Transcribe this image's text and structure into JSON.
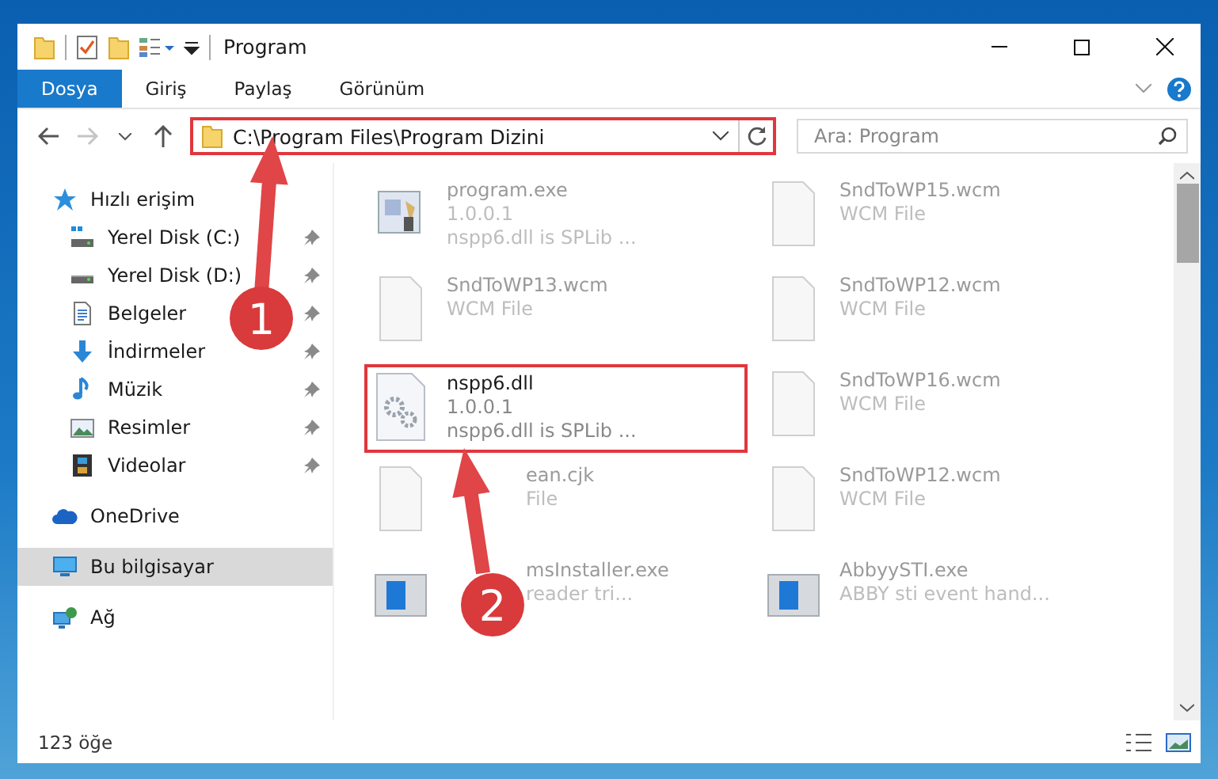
{
  "window": {
    "title": "Program"
  },
  "ribbon_tabs": [
    {
      "label": "Dosya",
      "selected": true
    },
    {
      "label": "Giriş",
      "selected": false
    },
    {
      "label": "Paylaş",
      "selected": false
    },
    {
      "label": "Görünüm",
      "selected": false
    }
  ],
  "address_bar": {
    "path": "C:\\Program Files\\Program Dizini",
    "highlighted": true
  },
  "search": {
    "placeholder": "Ara: Program"
  },
  "sidebar": {
    "items": [
      {
        "label": "Hızlı erişim",
        "kind": "star",
        "pinned": false,
        "selected": false,
        "children": [
          {
            "label": "Yerel Disk (C:)",
            "kind": "system-drive",
            "pinned": true,
            "selected": false
          },
          {
            "label": "Yerel Disk (D:)",
            "kind": "drive",
            "pinned": true,
            "selected": false
          },
          {
            "label": "Belgeler",
            "kind": "document",
            "pinned": true,
            "selected": false
          },
          {
            "label": "İndirmeler",
            "kind": "download",
            "pinned": true,
            "selected": false
          },
          {
            "label": "Müzik",
            "kind": "music",
            "pinned": true,
            "selected": false
          },
          {
            "label": "Resimler",
            "kind": "picture",
            "pinned": true,
            "selected": false
          },
          {
            "label": "Videolar",
            "kind": "video",
            "pinned": true,
            "selected": false
          }
        ]
      },
      {
        "label": "OneDrive",
        "kind": "cloud",
        "pinned": false,
        "selected": false
      },
      {
        "label": "Bu bilgisayar",
        "kind": "computer",
        "pinned": false,
        "selected": true
      },
      {
        "label": "Ağ",
        "kind": "network",
        "pinned": false,
        "selected": false
      }
    ]
  },
  "files": [
    {
      "kind": "exe",
      "name": "program.exe",
      "lines": [
        "1.0.0.1",
        "nspp6.dll is SPLib ..."
      ],
      "blurred": true,
      "highlighted": false,
      "partly_hidden": false
    },
    {
      "kind": "file",
      "name": "SndToWP15.wcm",
      "lines": [
        "WCM File"
      ],
      "blurred": true,
      "highlighted": false,
      "partly_hidden": false
    },
    {
      "kind": "file",
      "name": "SndToWP13.wcm",
      "lines": [
        "WCM File"
      ],
      "blurred": true,
      "highlighted": false,
      "partly_hidden": false
    },
    {
      "kind": "file",
      "name": "SndToWP12.wcm",
      "lines": [
        "WCM File"
      ],
      "blurred": true,
      "highlighted": false,
      "partly_hidden": false
    },
    {
      "kind": "dll",
      "name": "nspp6.dll",
      "lines": [
        "1.0.0.1",
        "nspp6.dll is SPLib ..."
      ],
      "blurred": false,
      "highlighted": true,
      "partly_hidden": false
    },
    {
      "kind": "file",
      "name": "SndToWP16.wcm",
      "lines": [
        "WCM File"
      ],
      "blurred": true,
      "highlighted": false,
      "partly_hidden": false
    },
    {
      "kind": "file",
      "name": "ean.cjk",
      "lines": [
        "File"
      ],
      "blurred": true,
      "highlighted": false,
      "partly_hidden": true
    },
    {
      "kind": "file",
      "name": "SndToWP12.wcm",
      "lines": [
        "WCM File"
      ],
      "blurred": true,
      "highlighted": false,
      "partly_hidden": false
    },
    {
      "kind": "installer",
      "name": "msInstaller.exe",
      "lines": [
        "reader tri..."
      ],
      "blurred": true,
      "highlighted": false,
      "partly_hidden": true
    },
    {
      "kind": "installer",
      "name": "AbbyySTI.exe",
      "lines": [
        "ABBY sti event hand..."
      ],
      "blurred": true,
      "highlighted": false,
      "partly_hidden": false
    }
  ],
  "status_bar": {
    "count": "123 öğe"
  },
  "annotations": [
    {
      "number": "1"
    },
    {
      "number": "2"
    }
  ]
}
